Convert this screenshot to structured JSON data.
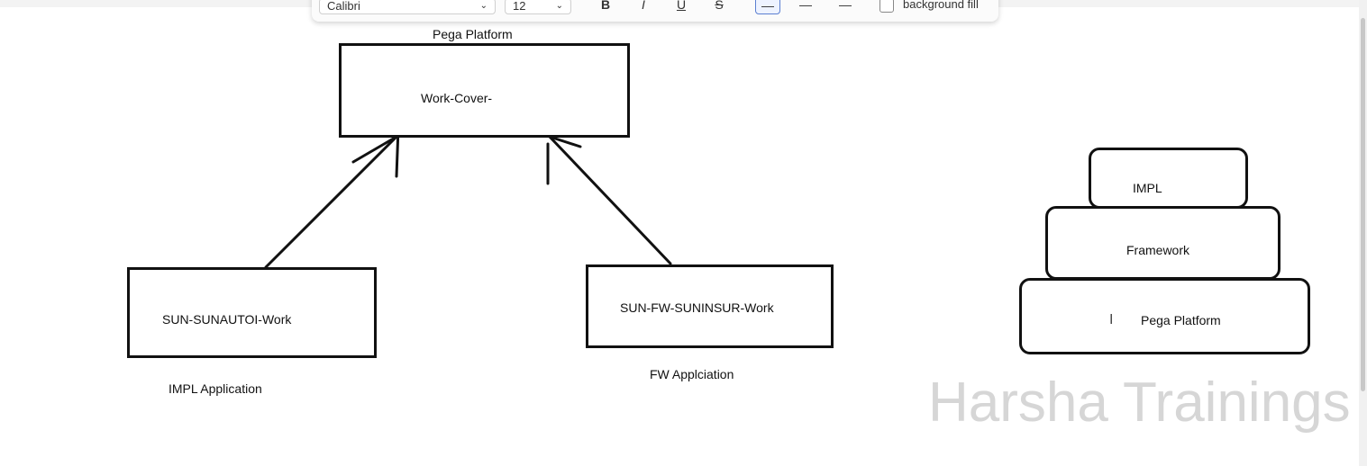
{
  "toolbar": {
    "font_name": "Calibri",
    "font_size": "12",
    "bold_glyph": "B",
    "italic_glyph": "I",
    "underline_glyph": "U",
    "strike_glyph": "S",
    "background_fill_label": "background fill"
  },
  "diagram": {
    "top_caption": "Pega Platform",
    "top_box": "Work-Cover-",
    "left_box": "SUN-SUNAUTOI-Work",
    "left_caption": "IMPL Application",
    "right_box": "SUN-FW-SUNINSUR-Work",
    "right_caption": "FW Applciation",
    "stack": {
      "top": "IMPL",
      "middle": "Framework",
      "bottom": "Pega Platform"
    }
  },
  "watermark": "Harsha Trainings"
}
